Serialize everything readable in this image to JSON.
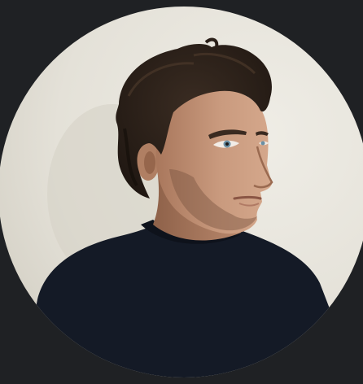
{
  "page": {
    "background_color": "#1f2124"
  },
  "avatar": {
    "shape": "circle",
    "subject": "portrait-photo",
    "colors": {
      "wall": "#e8e6df",
      "wall_shadow": "#d9d6cc",
      "hair": "#2a1f18",
      "skin": "#c99a7e",
      "skin_shadow": "#a9775c",
      "sweater": "#141a26"
    }
  }
}
